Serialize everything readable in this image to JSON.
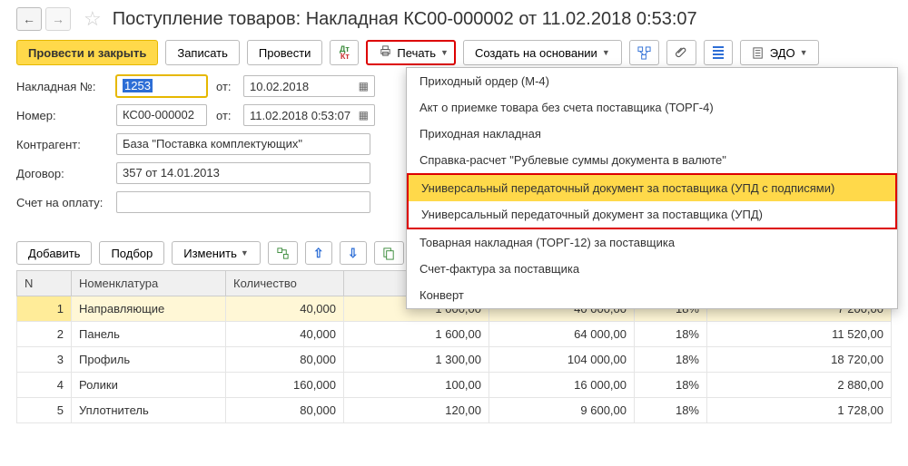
{
  "header": {
    "title": "Поступление товаров: Накладная КС00-000002 от 11.02.2018 0:53:07"
  },
  "toolbar": {
    "post_close": "Провести и закрыть",
    "save": "Записать",
    "post": "Провести",
    "print": "Печать",
    "create_based": "Создать на основании",
    "edo": "ЭДО"
  },
  "form": {
    "invoice_no_label": "Накладная №:",
    "invoice_no": "1253",
    "from1": "от:",
    "invoice_date": "10.02.2018",
    "number_label": "Номер:",
    "number": "КС00-000002",
    "from2": "от:",
    "doc_date": "11.02.2018  0:53:07",
    "counterparty_label": "Контрагент:",
    "counterparty": "База \"Поставка комплектующих\"",
    "contract_label": "Договор:",
    "contract": "357 от 14.01.2013",
    "bill_label": "Счет на оплату:"
  },
  "print_menu": [
    "Приходный ордер (М-4)",
    "Акт о приемке товара без счета поставщика (ТОРГ-4)",
    "Приходная накладная",
    "Справка-расчет \"Рублевые суммы документа в валюте\"",
    "Универсальный передаточный документ за поставщика (УПД с подписями)",
    "Универсальный передаточный документ за поставщика (УПД)",
    "Товарная накладная (ТОРГ-12) за поставщика",
    "Счет-фактура за поставщика",
    "Конверт"
  ],
  "table_toolbar": {
    "add": "Добавить",
    "select": "Подбор",
    "change": "Изменить"
  },
  "table": {
    "headers": {
      "n": "N",
      "item": "Номенклатура",
      "qty": "Количество"
    },
    "rows": [
      {
        "n": "1",
        "item": "Направляющие",
        "qty": "40,000",
        "price": "1 000,00",
        "sum": "40 000,00",
        "vat": "18%",
        "vatsum": "7 200,00"
      },
      {
        "n": "2",
        "item": "Панель",
        "qty": "40,000",
        "price": "1 600,00",
        "sum": "64 000,00",
        "vat": "18%",
        "vatsum": "11 520,00"
      },
      {
        "n": "3",
        "item": "Профиль",
        "qty": "80,000",
        "price": "1 300,00",
        "sum": "104 000,00",
        "vat": "18%",
        "vatsum": "18 720,00"
      },
      {
        "n": "4",
        "item": "Ролики",
        "qty": "160,000",
        "price": "100,00",
        "sum": "16 000,00",
        "vat": "18%",
        "vatsum": "2 880,00"
      },
      {
        "n": "5",
        "item": "Уплотнитель",
        "qty": "80,000",
        "price": "120,00",
        "sum": "9 600,00",
        "vat": "18%",
        "vatsum": "1 728,00"
      }
    ]
  }
}
